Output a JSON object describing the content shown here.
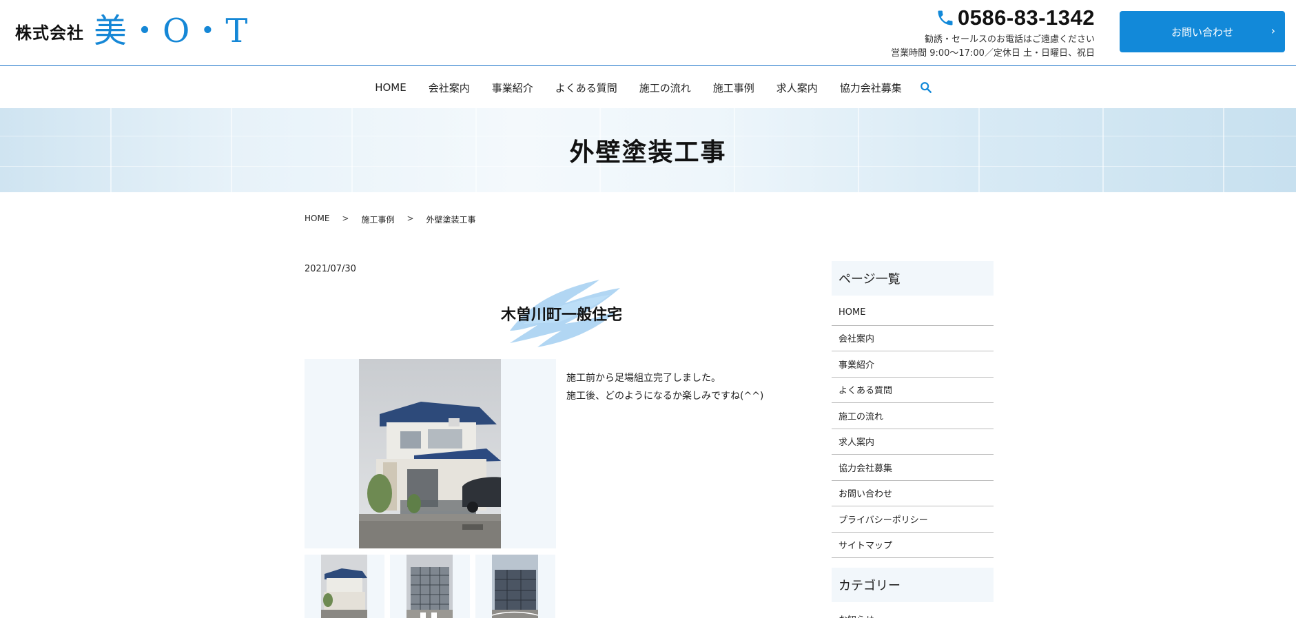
{
  "header": {
    "logo_text": "株式会社",
    "logo_mark": "美・O・T",
    "phone": "0586-83-1342",
    "note_line1": "勧誘・セールスのお電話はご遠慮ください",
    "note_line2": "営業時間 9:00〜17:00／定休日 土・日曜日、祝日",
    "cta_label": "お問い合わせ",
    "cta_arrow": "›"
  },
  "nav": {
    "items": [
      "HOME",
      "会社案内",
      "事業紹介",
      "よくある質問",
      "施工の流れ",
      "施工事例",
      "求人案内",
      "協力会社募集"
    ],
    "search_icon": "search-icon"
  },
  "hero": {
    "title": "外壁塗装工事"
  },
  "breadcrumb": {
    "items": [
      "HOME",
      "施工事例",
      "外壁塗装工事"
    ],
    "separator": ">"
  },
  "post": {
    "date": "2021/07/30",
    "title": "木曽川町一般住宅",
    "text_line1": "施工前から足場組立完了しました。",
    "text_line2": "施工後、どのようになるか楽しみですね(^^)"
  },
  "sidebar": {
    "heading1": "ページ一覧",
    "items": [
      "HOME",
      "会社案内",
      "事業紹介",
      "よくある質問",
      "施工の流れ",
      "求人案内",
      "協力会社募集",
      "お問い合わせ",
      "プライバシーポリシー",
      "サイトマップ"
    ],
    "heading2": "カテゴリー",
    "category_items": [
      "お知らせ"
    ]
  },
  "colors": {
    "accent": "#1289d9",
    "brand_blue": "#1587d6",
    "panel_bg": "#f2f7fb"
  }
}
